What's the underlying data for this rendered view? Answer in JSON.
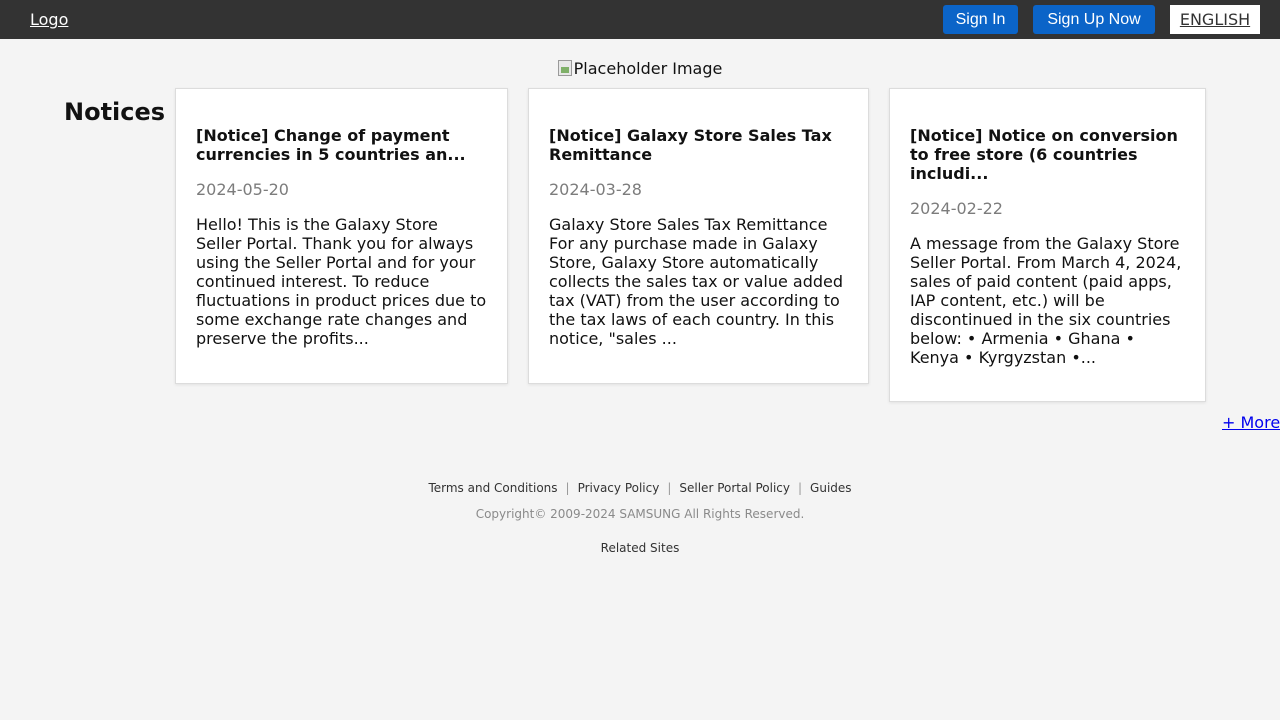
{
  "header": {
    "logo_text": "Logo",
    "sign_in_label": "Sign In",
    "sign_up_label": "Sign Up Now",
    "language_label": "ENGLISH",
    "bar_color": "#333333",
    "button_color": "#0b64c8"
  },
  "hero": {
    "image_alt": "Placeholder Image"
  },
  "notices": {
    "section_title": "Notices",
    "cards": [
      {
        "title": "[Notice] Change of payment currencies in 5 countries an...",
        "date": "2024-05-20",
        "body": "Hello! This is the Galaxy Store Seller Portal. Thank you for always using the Seller Portal and for your continued interest. To reduce fluctuations in product prices due to some exchange rate changes and preserve the profits..."
      },
      {
        "title": "[Notice] Galaxy Store Sales Tax Remittance",
        "date": "2024-03-28",
        "body": "Galaxy Store Sales Tax Remittance For any purchase made in Galaxy Store, Galaxy Store automatically collects the sales tax or value added tax (VAT) from the user according to the tax laws of each country. In this notice, \"sales ..."
      },
      {
        "title": "[Notice] Notice on conversion to free store (6 countries includi...",
        "date": "2024-02-22",
        "body": "A message from the Galaxy Store Seller Portal. From March 4, 2024, sales of paid content (paid apps, IAP content, etc.) will be discontinued in the six countries below: • Armenia • Ghana • Kenya • Kyrgyzstan •..."
      }
    ],
    "more_label": "+ More"
  },
  "footer": {
    "links": [
      "Terms and Conditions",
      "Privacy Policy",
      "Seller Portal Policy",
      "Guides"
    ],
    "separator": "|",
    "copyright": "Copyright© 2009-2024 SAMSUNG All Rights Reserved.",
    "related_sites": "Related Sites"
  }
}
